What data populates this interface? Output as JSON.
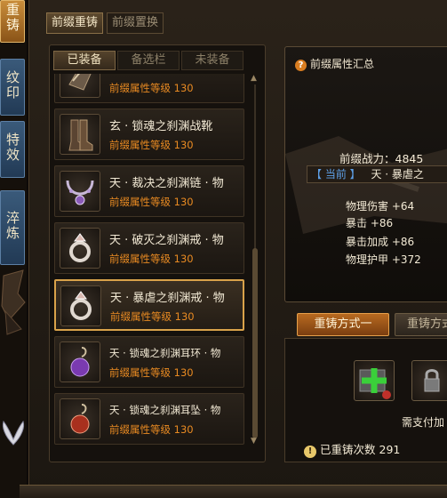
{
  "side_tabs": [
    "重铸",
    "纹印",
    "特效",
    "淬炼"
  ],
  "top_tabs": {
    "active": "前缀重铸",
    "inactive": "前缀置换"
  },
  "sub_tabs": [
    "已装备",
    "备选栏",
    "未装备"
  ],
  "items": [
    {
      "name": "",
      "level_label": "前缀属性等级",
      "level": "130",
      "icon": "gauntlet-icon"
    },
    {
      "name": "玄 · 锁魂之刹渊战靴",
      "level_label": "前缀属性等级",
      "level": "130",
      "icon": "boots-icon"
    },
    {
      "name": "天 · 裁决之刹渊链 · 物",
      "level_label": "前缀属性等级",
      "level": "130",
      "icon": "necklace-icon"
    },
    {
      "name": "天 · 破灭之刹渊戒 · 物",
      "level_label": "前缀属性等级",
      "level": "130",
      "icon": "ring-icon"
    },
    {
      "name": "天 · 暴虐之刹渊戒 · 物",
      "level_label": "前缀属性等级",
      "level": "130",
      "icon": "ring-icon",
      "selected": true
    },
    {
      "name": "天 · 锁魂之刹渊耳环 · 物",
      "level_label": "前缀属性等级",
      "level": "130",
      "icon": "earring-purple-icon"
    },
    {
      "name": "天 · 锁魂之刹渊耳坠 · 物",
      "level_label": "前缀属性等级",
      "level": "130",
      "icon": "earring-red-icon"
    }
  ],
  "summary": {
    "title": "前缀属性汇总",
    "power_label": "前缀战力：",
    "power_value": "4845",
    "current_tag": "【 当前 】",
    "current_name": "天 · 暴虐之",
    "stats": [
      "物理伤害 +64",
      "暴击 +86",
      "暴击加成 +86",
      "物理护甲 +372"
    ]
  },
  "reforge": {
    "method_active": "重铸方式一",
    "method_other": "重铸方式",
    "need_pay": "需支付加",
    "count_label": "已重铸次数",
    "count_value": "291"
  }
}
